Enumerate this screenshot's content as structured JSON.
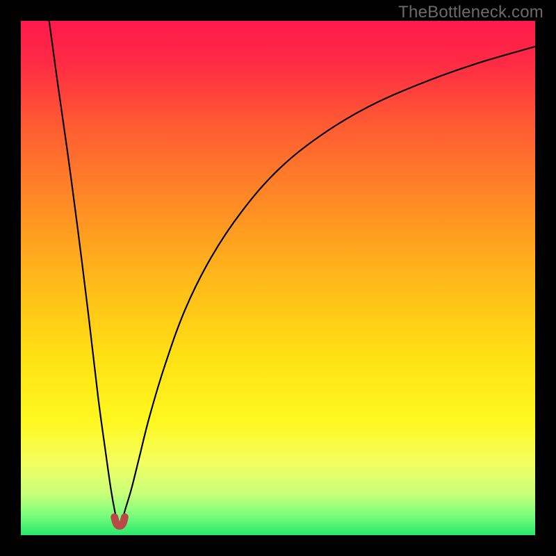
{
  "watermark": "TheBottleneck.com",
  "colors": {
    "gradient_stops": [
      {
        "offset": 0.0,
        "color": "#ff1a4b"
      },
      {
        "offset": 0.08,
        "color": "#ff2a44"
      },
      {
        "offset": 0.2,
        "color": "#ff5a33"
      },
      {
        "offset": 0.35,
        "color": "#ff8a25"
      },
      {
        "offset": 0.5,
        "color": "#ffb81a"
      },
      {
        "offset": 0.65,
        "color": "#ffe014"
      },
      {
        "offset": 0.78,
        "color": "#fff820"
      },
      {
        "offset": 0.86,
        "color": "#f2ff60"
      },
      {
        "offset": 0.92,
        "color": "#c8ff7a"
      },
      {
        "offset": 0.96,
        "color": "#7dff7d"
      },
      {
        "offset": 1.0,
        "color": "#28e86a"
      }
    ],
    "dip_stroke": "#b94a48"
  },
  "chart_data": {
    "type": "line",
    "title": "",
    "xlabel": "",
    "ylabel": "",
    "xlim": [
      0,
      100
    ],
    "ylim": [
      0,
      100
    ],
    "grid": false,
    "legend": false,
    "annotations": [
      "TheBottleneck.com"
    ],
    "notes": "Funnel-shaped curve: two branches descend from top edge to a narrow minimum near x≈19, y≈2, then right branch rises toward top-right. Minimum region drawn as small red U.",
    "series": [
      {
        "name": "left-branch",
        "x": [
          5.5,
          7,
          9,
          11,
          13,
          15,
          16.5,
          17.5,
          18.3,
          18.8
        ],
        "y": [
          100,
          89,
          75,
          60,
          44,
          27,
          16,
          9,
          4.5,
          2.5
        ]
      },
      {
        "name": "right-branch",
        "x": [
          19.6,
          20.3,
          21.5,
          23,
          25,
          28,
          32,
          37,
          43,
          50,
          58,
          67,
          77,
          88,
          100
        ],
        "y": [
          2.5,
          5,
          9,
          15,
          23,
          33,
          44,
          54,
          63,
          71,
          77.5,
          83,
          87.5,
          91.5,
          95
        ]
      },
      {
        "name": "dip",
        "x": [
          18.2,
          18.6,
          19.2,
          19.8,
          20.2
        ],
        "y": [
          3.5,
          2.2,
          1.8,
          2.2,
          3.5
        ]
      }
    ]
  }
}
